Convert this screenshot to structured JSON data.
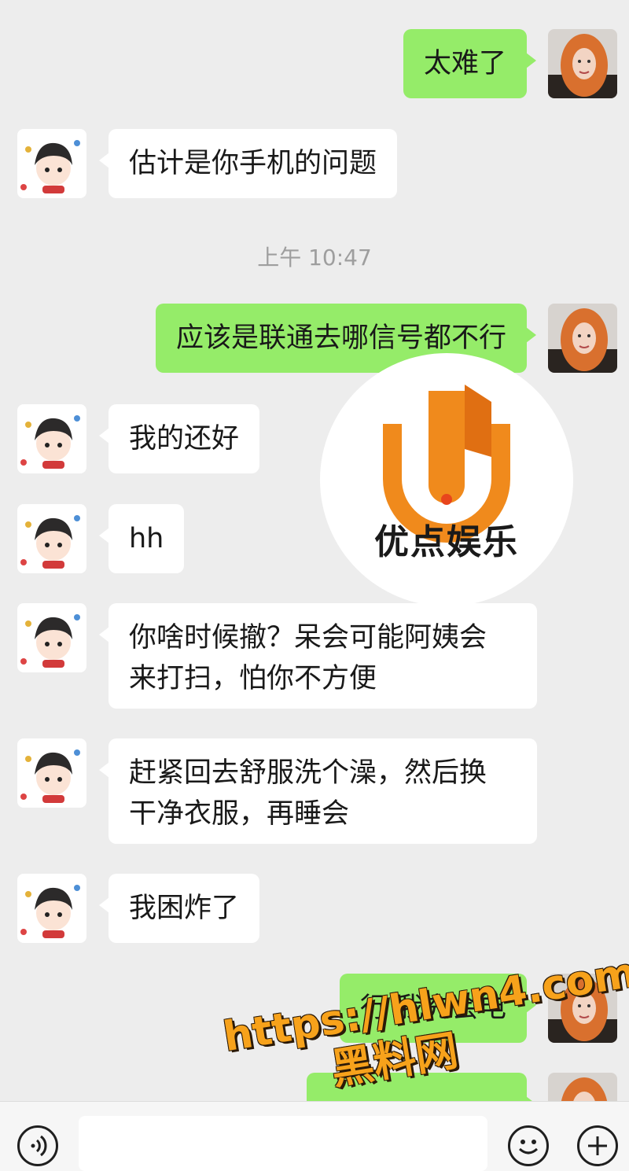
{
  "messages": [
    {
      "side": "right",
      "text": "太难了"
    },
    {
      "side": "left",
      "text": "估计是你手机的问题"
    },
    {
      "side": "right",
      "text": "应该是联通去哪信号都不行"
    },
    {
      "side": "left",
      "text": "我的还好"
    },
    {
      "side": "left",
      "text": "hh"
    },
    {
      "side": "left",
      "text": "你啥时候撤？呆会可能阿姨会\n来打扫，怕你不方便"
    },
    {
      "side": "left",
      "text": "赶紧回去舒服洗个澡，然后换\n干净衣服，再睡会"
    },
    {
      "side": "left",
      "text": "我困炸了"
    },
    {
      "side": "right",
      "text": "行 我充会电"
    }
  ],
  "timestamp": "上午 10:47",
  "logo": {
    "text": "优点娱乐",
    "color": "#f08a1c"
  },
  "watermark": {
    "line1": "https://hlwn4.com",
    "line2": "黑料网",
    "color": "#f7a21b"
  },
  "colors": {
    "sent_bubble": "#95ec69",
    "received_bubble": "#ffffff",
    "background": "#ededed"
  },
  "icons": {
    "voice": "voice-icon",
    "emoji": "emoji-icon",
    "plus": "plus-icon"
  }
}
